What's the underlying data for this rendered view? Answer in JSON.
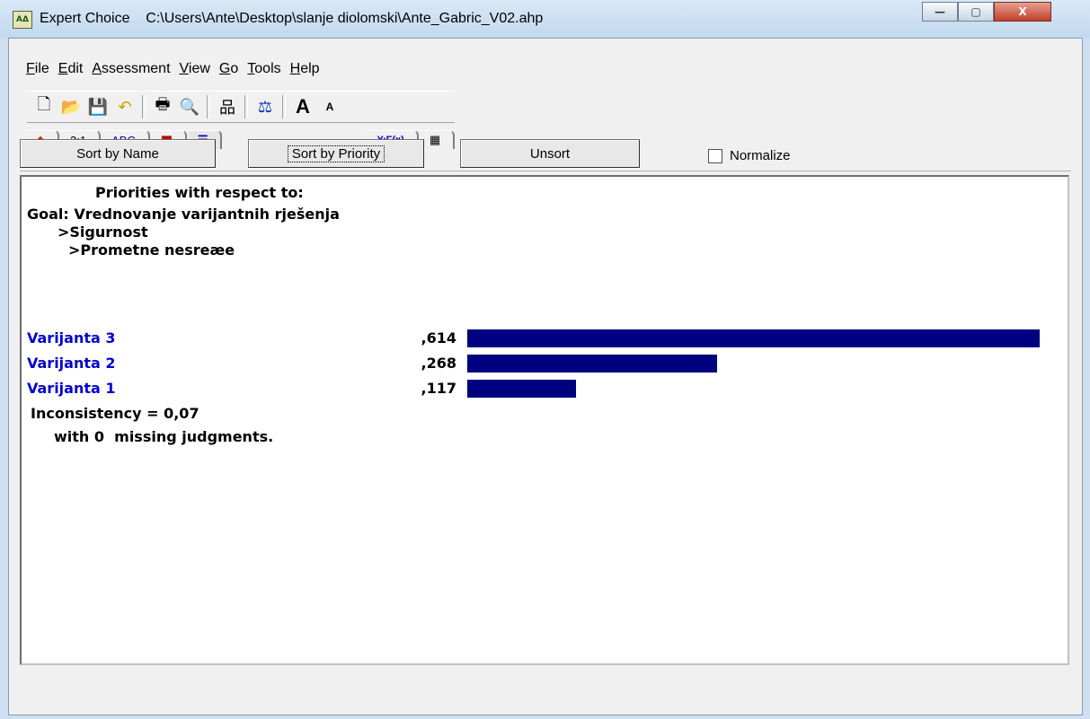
{
  "window": {
    "title": "Expert Choice    C:\\Users\\Ante\\Desktop\\slanje diolomski\\Ante_Gabric_V02.ahp",
    "icon": "app-logo-icon",
    "controls": {
      "minimize": "—",
      "maximize": "▢",
      "close": "X"
    }
  },
  "menu": [
    {
      "label": "File",
      "accel": "F"
    },
    {
      "label": "Edit",
      "accel": "E"
    },
    {
      "label": "Assessment",
      "accel": "A"
    },
    {
      "label": "View",
      "accel": "V"
    },
    {
      "label": "Go",
      "accel": "G"
    },
    {
      "label": "Tools",
      "accel": "T"
    },
    {
      "label": "Help",
      "accel": "H"
    }
  ],
  "toolbar_icons": [
    "new-icon",
    "open-icon",
    "save-icon",
    "undo-icon",
    "print-icon",
    "print-preview-icon",
    "hierarchy-icon",
    "balance-icon",
    "font-larger-icon",
    "font-smaller-icon"
  ],
  "tabs": [
    {
      "label": "",
      "icon": "blocks-icon"
    },
    {
      "label": "3:1"
    },
    {
      "label": "ABC"
    },
    {
      "label": "",
      "icon": "equal-bars-icon"
    },
    {
      "label": "",
      "icon": "sort-bars-icon",
      "active": true
    },
    {
      "label": "Y:F(x)"
    },
    {
      "label": "",
      "icon": "table-icon"
    }
  ],
  "buttons": {
    "sort_by_name": "Sort by Name",
    "sort_by_priority": "Sort by Priority",
    "unsort": "Unsort",
    "normalize": "Normalize"
  },
  "report": {
    "heading": "Priorities with respect to:",
    "goal": "Goal: Vrednovanje varijantnih rješenja",
    "level1": ">Sigurnost",
    "level2": ">Prometne nesreæe",
    "items": [
      {
        "name": "Varijanta 3",
        "value": ",614",
        "priority": 0.614
      },
      {
        "name": "Varijanta 2",
        "value": ",268",
        "priority": 0.268
      },
      {
        "name": "Varijanta 1",
        "value": ",117",
        "priority": 0.117
      }
    ],
    "inconsistency": "Inconsistency = 0,07",
    "missing": "with 0  missing judgments."
  }
}
